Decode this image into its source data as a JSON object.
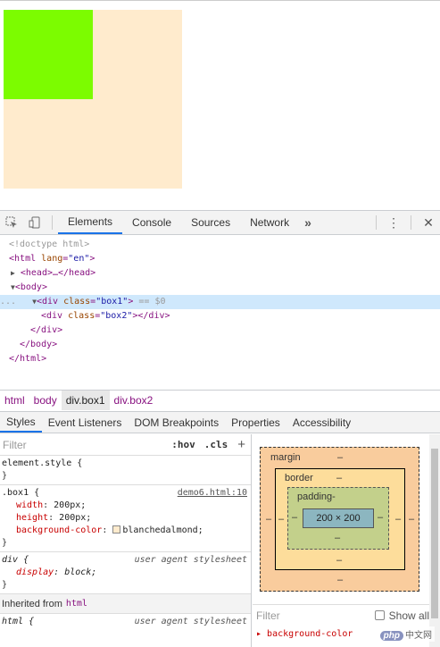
{
  "preview": {
    "box1_color": "#ffebcd",
    "box2_color": "#7cfc00"
  },
  "toolbar": {
    "inspect_icon": "select-element-icon",
    "device_icon": "device-toolbar-icon",
    "tabs": [
      "Elements",
      "Console",
      "Sources",
      "Network"
    ],
    "more": "»",
    "menu_icon": "⋮",
    "close_icon": "✕"
  },
  "dom": {
    "doctype": "<!doctype html>",
    "html_open_tag": "html",
    "html_attr": "lang",
    "html_val": "\"en\"",
    "head": "<head>…</head>",
    "body_tag": "body",
    "div1_attr": "class",
    "div1_val": "\"box1\"",
    "div1_eq": "== $0",
    "div2_val": "\"box2\"",
    "close_div": "</div>",
    "close_body": "</body>",
    "close_html": "</html>",
    "ellipsis": "..."
  },
  "breadcrumb": [
    "html",
    "body",
    "div.box1",
    "div.box2"
  ],
  "subtabs": [
    "Styles",
    "Event Listeners",
    "DOM Breakpoints",
    "Properties",
    "Accessibility"
  ],
  "styles": {
    "filter_placeholder": "Filter",
    "hov": ":hov",
    "cls": ".cls",
    "plus": "+",
    "element_style": "element.style {",
    "close_brace": "}",
    "box1_selector": ".box1 {",
    "box1_source": "demo6.html:10",
    "width_name": "width",
    "width_val": "200px;",
    "height_name": "height",
    "height_val": "200px;",
    "bg_name": "background-color",
    "bg_val": "blanchedalmond;",
    "bg_swatch": "#ffebcd",
    "div_selector": "div {",
    "ua_label": "user agent stylesheet",
    "display_name": "display",
    "display_val": "block;",
    "inherited_label": "Inherited from",
    "inherited_tag": "html",
    "html_selector": "html {",
    "html_ua_label": "user agent stylesheet"
  },
  "boxmodel": {
    "margin_label": "margin",
    "border_label": "border",
    "padding_label": "padding-",
    "dash": "–",
    "content": "200 × 200"
  },
  "computed": {
    "filter_placeholder": "Filter",
    "show_all": "Show all",
    "first_prop": "background-color"
  },
  "watermark": {
    "logo": "php",
    "text": "中文网"
  }
}
